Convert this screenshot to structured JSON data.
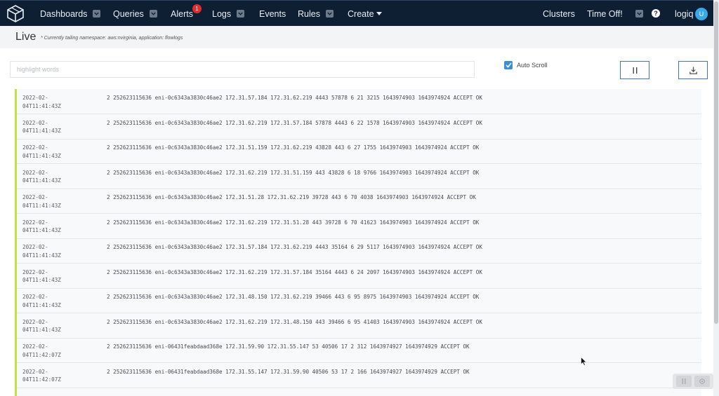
{
  "nav": {
    "items": [
      {
        "label": "Dashboards",
        "caret": true
      },
      {
        "label": "Queries",
        "caret": true
      },
      {
        "label": "Alerts",
        "caret": false
      },
      {
        "label": "Logs",
        "caret": true
      },
      {
        "label": "Events",
        "caret": false
      },
      {
        "label": "Rules",
        "caret": true
      },
      {
        "label": "Create",
        "caret": "triangle"
      }
    ],
    "alerts_badge": "1",
    "right": {
      "clusters": "Clusters",
      "time_off": "Time Off!",
      "help": "?",
      "user": "logiq",
      "avatar": "U"
    }
  },
  "page": {
    "title": "Live",
    "subtitle": "* Currently tailing namespace: aws:nvirginia, application: flowlogs"
  },
  "toolbar": {
    "highlight_placeholder": "highlight words",
    "highlight_value": "",
    "auto_scroll_label": "Auto Scroll",
    "auto_scroll_checked": true,
    "pause_icon": "pause-icon",
    "download_icon": "download-icon"
  },
  "logs": [
    {
      "ts1": "2022-02-",
      "ts2": "04T11:41:43Z",
      "msg": "2 252623115636 eni-0c6343a3830c46ae2 172.31.57.184 172.31.62.219 4443 57878 6 21 3215 1643974903 1643974924 ACCEPT OK"
    },
    {
      "ts1": "2022-02-",
      "ts2": "04T11:41:43Z",
      "msg": "2 252623115636 eni-0c6343a3830c46ae2 172.31.62.219 172.31.57.184 57878 4443 6 22 1578 1643974903 1643974924 ACCEPT OK"
    },
    {
      "ts1": "2022-02-",
      "ts2": "04T11:41:43Z",
      "msg": "2 252623115636 eni-0c6343a3830c46ae2 172.31.51.159 172.31.62.219 43828 443 6 27 1755 1643974903 1643974924 ACCEPT OK"
    },
    {
      "ts1": "2022-02-",
      "ts2": "04T11:41:43Z",
      "msg": "2 252623115636 eni-0c6343a3830c46ae2 172.31.62.219 172.31.51.159 443 43828 6 18 9766 1643974903 1643974924 ACCEPT OK"
    },
    {
      "ts1": "2022-02-",
      "ts2": "04T11:41:43Z",
      "msg": "2 252623115636 eni-0c6343a3830c46ae2 172.31.51.28 172.31.62.219 39728 443 6 70 4038 1643974903 1643974924 ACCEPT OK"
    },
    {
      "ts1": "2022-02-",
      "ts2": "04T11:41:43Z",
      "msg": "2 252623115636 eni-0c6343a3830c46ae2 172.31.62.219 172.31.51.28 443 39728 6 70 41623 1643974903 1643974924 ACCEPT OK"
    },
    {
      "ts1": "2022-02-",
      "ts2": "04T11:41:43Z",
      "msg": "2 252623115636 eni-0c6343a3830c46ae2 172.31.57.184 172.31.62.219 4443 35164 6 29 5117 1643974903 1643974924 ACCEPT OK"
    },
    {
      "ts1": "2022-02-",
      "ts2": "04T11:41:43Z",
      "msg": "2 252623115636 eni-0c6343a3830c46ae2 172.31.62.219 172.31.57.184 35164 4443 6 24 2097 1643974903 1643974924 ACCEPT OK"
    },
    {
      "ts1": "2022-02-",
      "ts2": "04T11:41:43Z",
      "msg": "2 252623115636 eni-0c6343a3830c46ae2 172.31.48.150 172.31.62.219 39466 443 6 95 8975 1643974903 1643974924 ACCEPT OK"
    },
    {
      "ts1": "2022-02-",
      "ts2": "04T11:41:43Z",
      "msg": "2 252623115636 eni-0c6343a3830c46ae2 172.31.62.219 172.31.48.150 443 39466 6 95 41403 1643974903 1643974924 ACCEPT OK"
    },
    {
      "ts1": "2022-02-",
      "ts2": "04T11:42:07Z",
      "msg": "2 252623115636 eni-06431feabdaad368e 172.31.59.90 172.31.55.147 53 40506 17 2 312 1643974927 1643974929 ACCEPT OK"
    },
    {
      "ts1": "2022-02-",
      "ts2": "04T11:42:07Z",
      "msg": "2 252623115636 eni-06431feabdaad368e 172.31.55.147 172.31.59.90 40506 53 17 2 166 1643974927 1643974929 ACCEPT OK"
    }
  ],
  "colors": {
    "navbar_bg": "#0e1f33",
    "accent_blue": "#3f72c4",
    "log_border": "#c6df47",
    "badge_red": "#e02d2d",
    "avatar_blue": "#3aa8e8"
  }
}
